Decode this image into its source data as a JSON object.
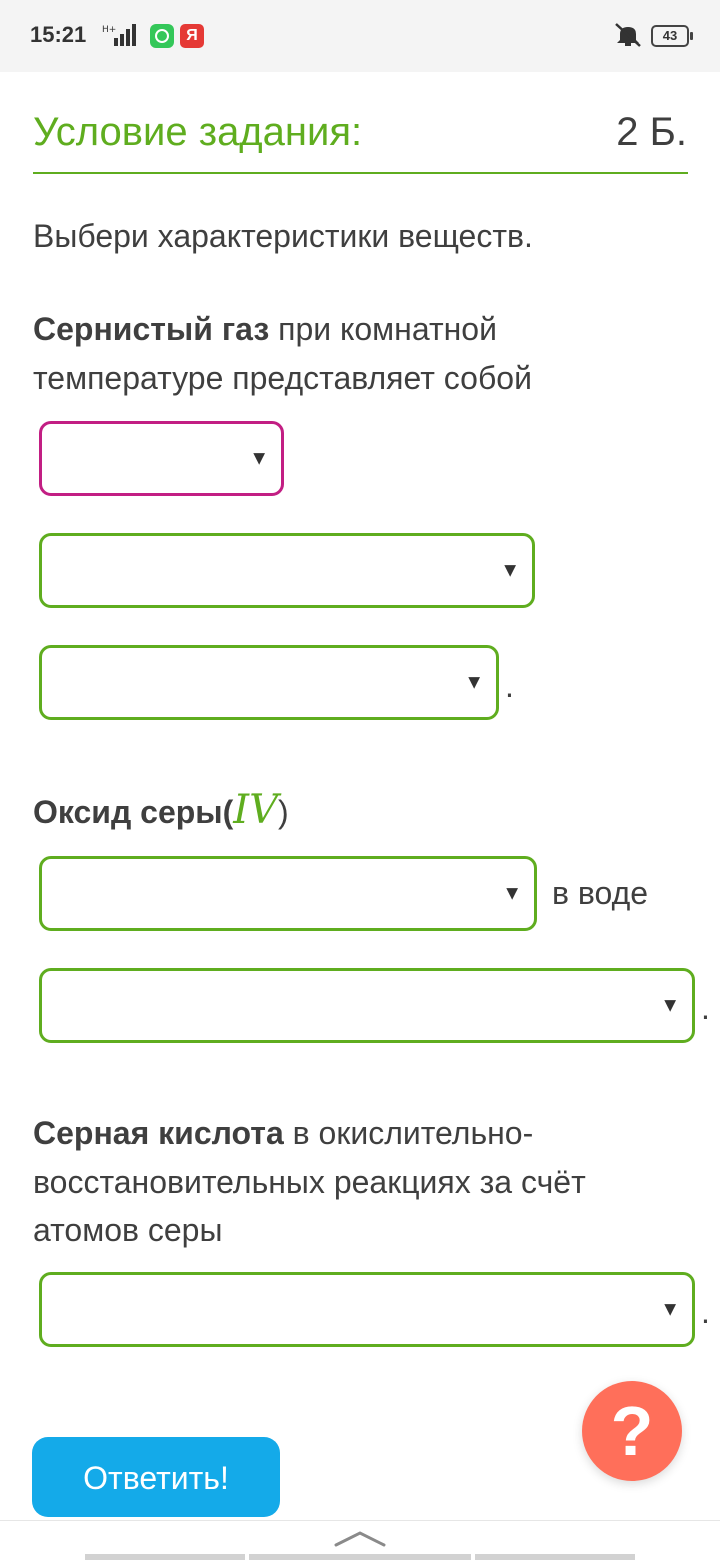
{
  "status_bar": {
    "time": "15:21",
    "network_label": "H+",
    "app2_letter": "Я",
    "battery": "43"
  },
  "header": {
    "title": "Условие задания:",
    "score": "2 Б."
  },
  "instruction": "Выбери характеристики веществ.",
  "q1": {
    "bold": "Сернистый газ",
    "text1": " при комнатной",
    "text2": "температуре представляет собой"
  },
  "q2": {
    "bold": "Оксид серы(",
    "roman": "IV",
    "close": ")",
    "suffix": "в воде"
  },
  "q3": {
    "bold": "Серная кислота",
    "text1": " в окислительно-",
    "text2": "восстановительных реакциях за счёт",
    "text3": "атомов серы"
  },
  "punctuation": ".",
  "buttons": {
    "answer": "Ответить!",
    "help": "?"
  },
  "colors": {
    "accent_green": "#5fad1f",
    "active_select": "#c21e83",
    "answer_button": "#14aae9",
    "help_button": "#ff6f5a"
  }
}
